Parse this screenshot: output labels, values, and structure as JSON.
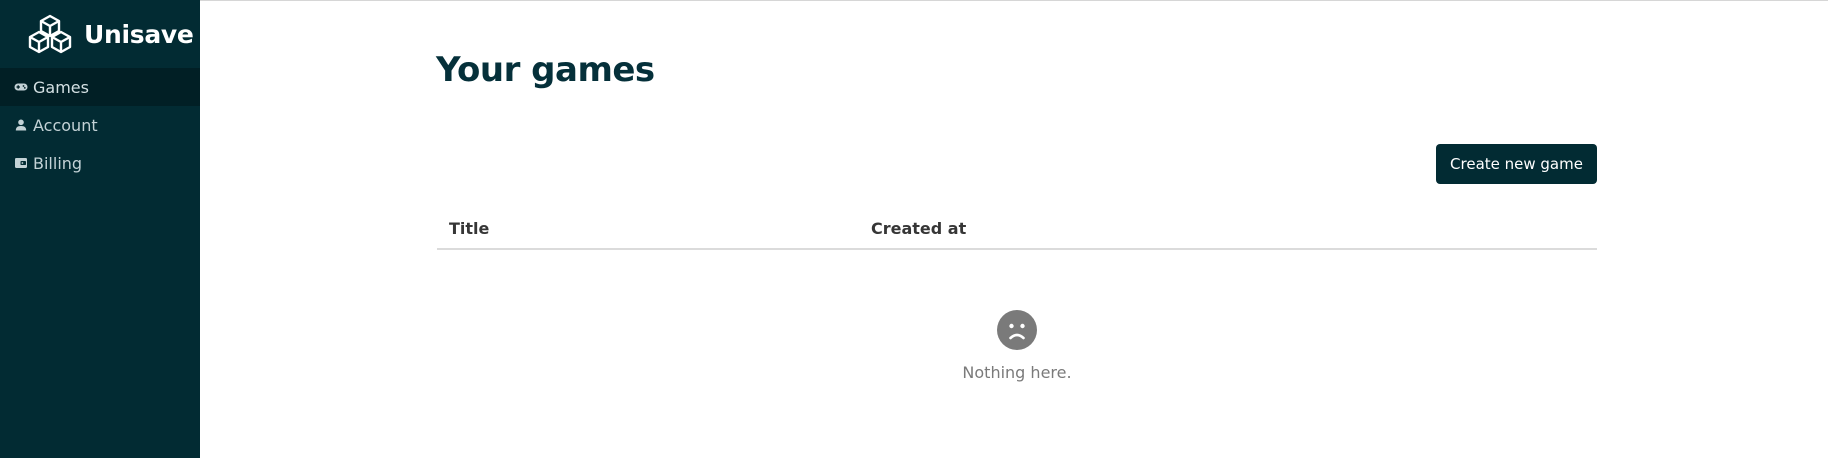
{
  "app": {
    "name": "Unisave"
  },
  "sidebar": {
    "items": [
      {
        "label": "Games",
        "icon": "gamepad-icon",
        "active": true
      },
      {
        "label": "Account",
        "icon": "person-icon",
        "active": false
      },
      {
        "label": "Billing",
        "icon": "wallet-icon",
        "active": false
      }
    ]
  },
  "main": {
    "title": "Your games",
    "create_button_label": "Create new game",
    "table": {
      "columns": [
        "Title",
        "Created at"
      ],
      "rows": []
    },
    "empty_state": {
      "text": "Nothing here.",
      "icon": "sad-face-icon"
    }
  },
  "colors": {
    "sidebar_bg": "#022b33",
    "sidebar_active_bg": "#011f25",
    "primary_button": "#022b33",
    "title_text": "#05303a",
    "empty_icon": "#7a7a7a"
  }
}
